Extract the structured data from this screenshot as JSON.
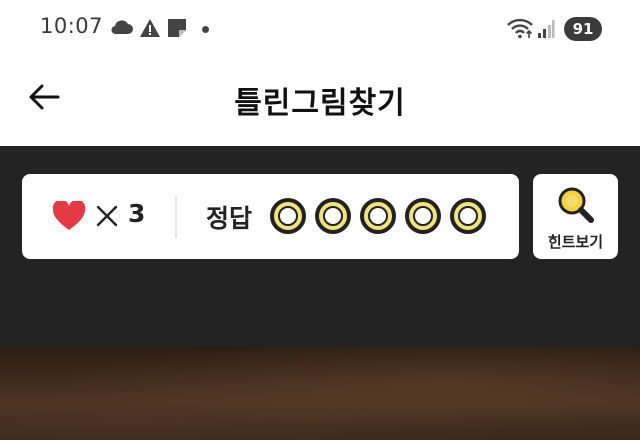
{
  "status_bar": {
    "time": "10:07",
    "battery_level": "91",
    "icons": [
      "cloud-icon",
      "alert-icon",
      "note-icon",
      "dot-icon",
      "wifi-icon",
      "signal-icon"
    ]
  },
  "header": {
    "title": "틀린그림찾기",
    "back_icon": "arrow-left-icon"
  },
  "score_panel": {
    "lives_icon": "heart-icon",
    "multiply_symbol": "×",
    "lives_count": "3",
    "answer_label": "정답",
    "answers_found": 0,
    "answers_total": 5
  },
  "hint_button": {
    "label": "힌트보기",
    "icon": "magnifier-icon"
  },
  "colors": {
    "game_background": "#232323",
    "heart": "#e53946",
    "slot_ring": "#f1e27a",
    "hint_icon": "#f3d33c"
  }
}
